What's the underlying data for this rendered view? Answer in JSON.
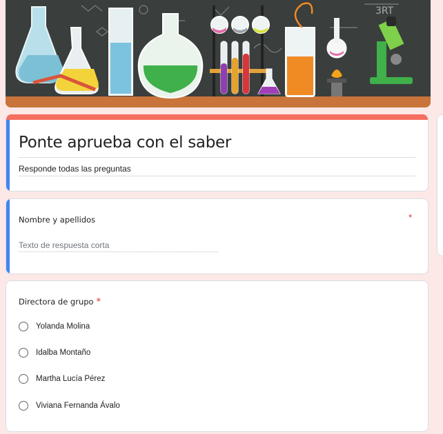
{
  "form": {
    "title": "Ponte aprueba con el saber",
    "description": "Responde todas las preguntas",
    "header_theme": "science-lab-illustration",
    "accent_color": "#f46e61",
    "focus_color": "#4285f4",
    "background_color": "#fce8e6"
  },
  "questions": [
    {
      "title": "Nombre y apellidos",
      "required_mark": "*",
      "type": "short-answer",
      "placeholder": "Texto de respuesta corta"
    },
    {
      "title": "Directora de grupo",
      "required_mark": "*",
      "type": "multiple-choice",
      "options": [
        "Yolanda Molina",
        "Idalba Montaño",
        "Martha Lucía Pérez",
        "Viviana Fernanda Ávalo"
      ]
    }
  ]
}
